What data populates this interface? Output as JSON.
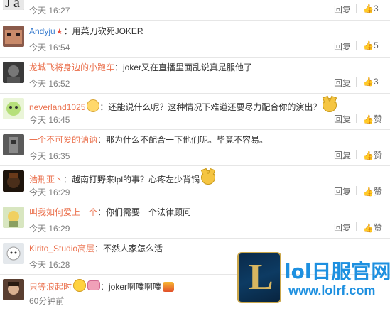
{
  "comments": [
    {
      "user": "",
      "badge": "",
      "text": "",
      "time": "今天 16:27",
      "reply": "回复",
      "likes": "3",
      "avatar_color": "#2b2b2b"
    },
    {
      "user": "Andyju",
      "badge": "★",
      "text": "：用菜刀砍死JOKER",
      "time": "今天 16:54",
      "reply": "回复",
      "likes": "5",
      "avatar_color": "#5a3a3a"
    },
    {
      "user": "龙城飞将身边的小跑车",
      "badge": "",
      "text": "：joker又在直播里面乱说真是服他了",
      "time": "今天 16:52",
      "reply": "回复",
      "likes": "3",
      "avatar_color": "#3a3a3a"
    },
    {
      "user": "neverland1025",
      "badge": "",
      "text": "：还能说什么呢？这种情况下难道还要尽力配合你的演出？",
      "time": "今天 16:45",
      "reply": "回复",
      "likes": "赞",
      "avatar_color": "#d9f0c0"
    },
    {
      "user": "一个不可爱的讷讷",
      "badge": "",
      "text": "：那为什么不配合一下他们呢。毕竟不容易。",
      "time": "今天 16:35",
      "reply": "回复",
      "likes": "赞",
      "avatar_color": "#4a4a4a"
    },
    {
      "user": "浩刑亚丶",
      "badge": "",
      "text": "：越南打野来lpl的事？心疼左少背锅",
      "time": "今天 16:29",
      "reply": "回复",
      "likes": "赞",
      "avatar_color": "#2a1a10"
    },
    {
      "user": "叫我如何爱上一个",
      "badge": "",
      "text": "：你们需要一个法律顾问",
      "time": "今天 16:29",
      "reply": "回复",
      "likes": "赞",
      "avatar_color": "#9ab07a"
    },
    {
      "user": "Kirito_Studio高层",
      "badge": "",
      "text": "：不然人家怎么活",
      "time": "今天 16:28",
      "reply": "回复",
      "likes": "赞",
      "avatar_color": "#cfd4da"
    },
    {
      "user": "只等浪起时",
      "badge": "",
      "text": "：joker啊噗啊噗",
      "time": "60分钟前",
      "reply": "回复",
      "likes": "赞",
      "avatar_color": "#6b4a3a"
    }
  ],
  "watermark": {
    "logo_letter": "L",
    "title": "lol日服官网",
    "url": "www.lolrf.com"
  }
}
